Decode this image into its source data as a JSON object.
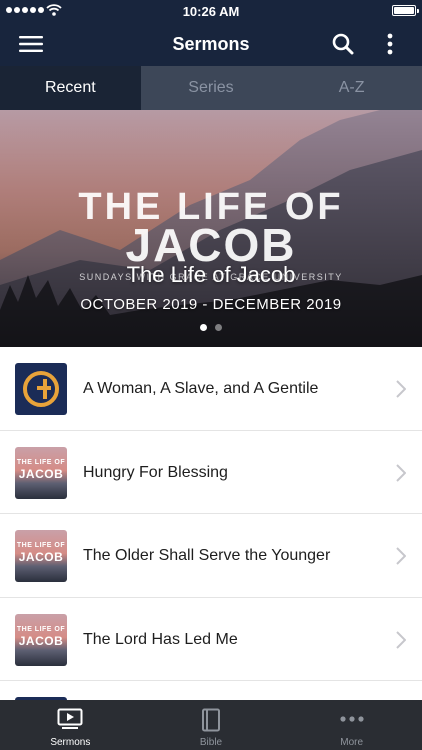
{
  "status_bar": {
    "time": "10:26 AM"
  },
  "nav": {
    "title": "Sermons",
    "menu_icon": "hamburger-menu-icon",
    "search_icon": "search-icon",
    "more_icon": "vertical-ellipsis-icon"
  },
  "tabs": [
    {
      "label": "Recent",
      "active": true
    },
    {
      "label": "Series",
      "active": false
    },
    {
      "label": "A-Z",
      "active": false
    }
  ],
  "hero": {
    "art_title_line1": "THE LIFE OF",
    "art_title_line2": "JACOB",
    "art_subtitle": "SUNDAYS WITH GRACE AT GRACE UNIVERSITY",
    "series_title": "The Life of Jacob",
    "dates": "OCTOBER 2019 - DECEMBER 2019",
    "page_count": 2,
    "active_page": 1
  },
  "sermons": [
    {
      "title": "A Woman, A Slave, and A Gentile",
      "thumb": "church-logo"
    },
    {
      "title": "Hungry For Blessing",
      "thumb": "the-life-of-jacob",
      "thumb_line1": "THE LIFE OF",
      "thumb_line2": "JACOB"
    },
    {
      "title": "The Older Shall Serve the Younger",
      "thumb": "the-life-of-jacob",
      "thumb_line1": "THE LIFE OF",
      "thumb_line2": "JACOB"
    },
    {
      "title": "The Lord Has Led Me",
      "thumb": "the-life-of-jacob",
      "thumb_line1": "THE LIFE OF",
      "thumb_line2": "JACOB"
    }
  ],
  "tab_bar": [
    {
      "label": "Sermons",
      "icon": "video-play-icon",
      "active": true
    },
    {
      "label": "Bible",
      "icon": "book-icon",
      "active": false
    },
    {
      "label": "More",
      "icon": "horizontal-ellipsis-icon",
      "active": false
    }
  ],
  "colors": {
    "nav_bg": "#18253d",
    "tab_active_bg": "#1a2435",
    "tab_inactive_bg": "#3d4758",
    "tabbar_bg": "#2a2d33",
    "logo_bg": "#1b2c57",
    "logo_accent": "#e8a33a"
  }
}
